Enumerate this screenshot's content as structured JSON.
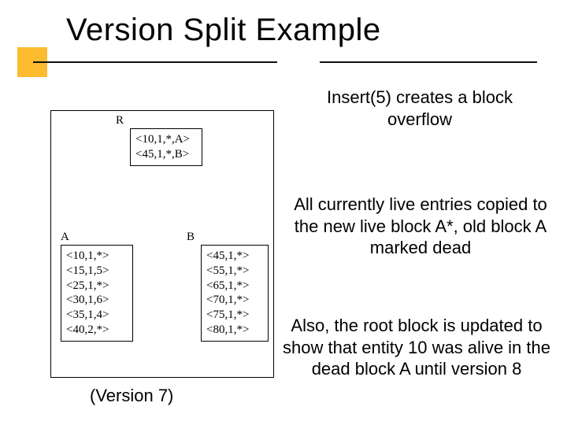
{
  "title": "Version Split Example",
  "figure": {
    "labels": {
      "R": "R",
      "A": "A",
      "B": "B"
    },
    "R": {
      "entries": [
        "<10,1,*,A>",
        "<45,1,*,B>"
      ]
    },
    "A": {
      "entries": [
        "<10,1,*>",
        "<15,1,5>",
        "<25,1,*>",
        "<30,1,6>",
        "<35,1,4>",
        "<40,2,*>"
      ]
    },
    "B": {
      "entries": [
        "<45,1,*>",
        "<55,1,*>",
        "<65,1,*>",
        "<70,1,*>",
        "<75,1,*>",
        "<80,1,*>"
      ]
    }
  },
  "caption": "(Version 7)",
  "paragraphs": {
    "p1": "Insert(5) creates a block overflow",
    "p2": "All currently live entries copied to the new live block A*, old block A marked dead",
    "p3": "Also, the root block is updated to show that entity 10 was alive in the dead block A until version 8"
  }
}
